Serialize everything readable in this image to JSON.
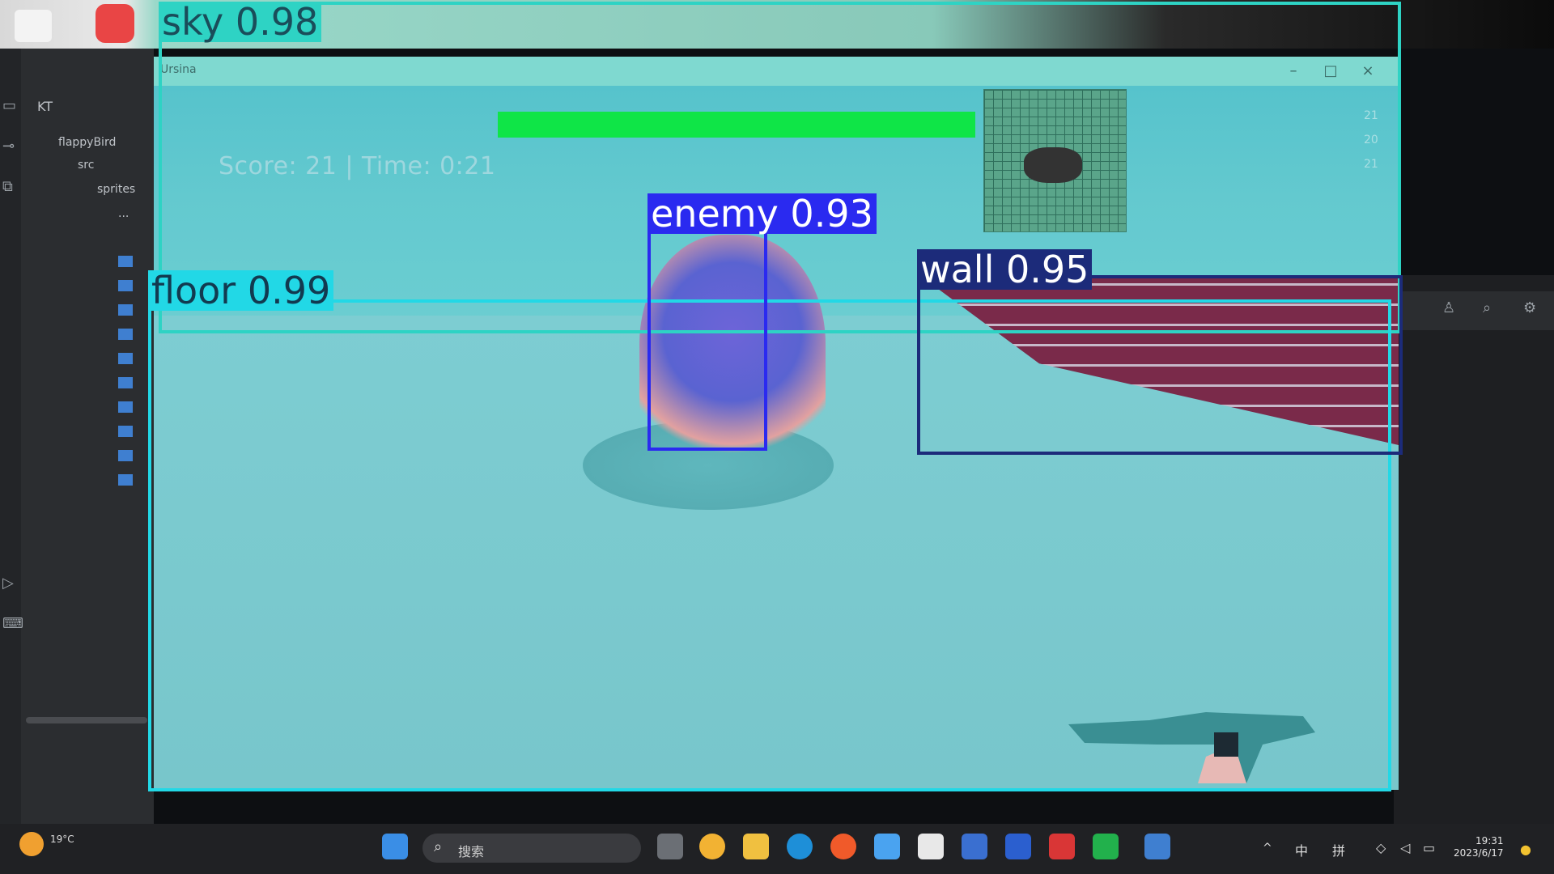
{
  "window": {
    "title": "Ursina",
    "controls": [
      "–",
      "□",
      "×"
    ]
  },
  "hud": {
    "score_text": "Score: 21 | Time: 0:21",
    "side_numbers": [
      "21",
      "20",
      "21"
    ]
  },
  "detections": [
    {
      "label": "sky",
      "confidence": "0.98",
      "color": "#2ed3c4",
      "label_color": "#1a4d5a"
    },
    {
      "label": "enemy",
      "confidence": "0.93",
      "color": "#2a2af0",
      "label_color": "#ffffff"
    },
    {
      "label": "wall",
      "confidence": "0.95",
      "color": "#1c2b7a",
      "label_color": "#ffffff"
    },
    {
      "label": "floor",
      "confidence": "0.99",
      "color": "#22d8e6",
      "label_color": "#123a50"
    }
  ],
  "ide": {
    "project_label": "KT",
    "tree_items": [
      "flappyBird",
      "src",
      "sprites",
      "..."
    ]
  },
  "taskbar": {
    "search_placeholder": "搜索",
    "weather": "19°C",
    "clock_time": "19:31",
    "clock_date": "2023/6/17",
    "tray_labels": [
      "中",
      "拼"
    ]
  },
  "icons": [
    "windows-start-icon",
    "search-icon",
    "task-view-icon",
    "file-explorer-icon",
    "edge-icon",
    "firefox-icon",
    "store-icon",
    "python-icon"
  ]
}
